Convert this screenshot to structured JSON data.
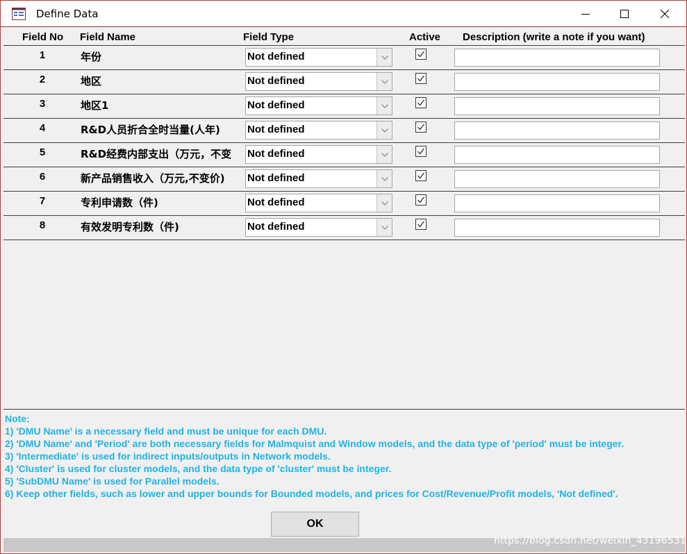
{
  "window": {
    "title": "Define Data",
    "icon": "form-icon"
  },
  "columns": {
    "field_no": "Field No",
    "field_name": "Field Name",
    "field_type": "Field Type",
    "active": "Active",
    "description": "Description (write a note if you want)"
  },
  "rows": [
    {
      "no": "1",
      "name": "年份",
      "type": "Not defined",
      "active": true,
      "description": ""
    },
    {
      "no": "2",
      "name": "地区",
      "type": "Not defined",
      "active": true,
      "description": ""
    },
    {
      "no": "3",
      "name": "地区1",
      "type": "Not defined",
      "active": true,
      "description": ""
    },
    {
      "no": "4",
      "name": "R&D人员折合全时当量(人年)",
      "type": "Not defined",
      "active": true,
      "description": ""
    },
    {
      "no": "5",
      "name": "R&D经费内部支出（万元，不变",
      "type": "Not defined",
      "active": true,
      "description": ""
    },
    {
      "no": "6",
      "name": "新产品销售收入（万元,不变价)",
      "type": "Not defined",
      "active": true,
      "description": ""
    },
    {
      "no": "7",
      "name": "专利申请数（件)",
      "type": "Not defined",
      "active": true,
      "description": ""
    },
    {
      "no": "8",
      "name": "有效发明专利数（件)",
      "type": "Not defined",
      "active": true,
      "description": ""
    }
  ],
  "notes": [
    "Note:",
    "1) 'DMU Name' is a necessary field and must be unique for each DMU.",
    "2) 'DMU Name' and 'Period' are both necessary fields for Malmquist and Window models,  and the data type of 'period' must be integer.",
    "3) 'Intermediate' is used for indirect inputs/outputs  in Network models.",
    "4) 'Cluster' is used for cluster models,  and the data type of  'cluster' must be integer.",
    "5) 'SubDMU Name' is used for Parallel models.",
    "6)  Keep other fields, such as lower and upper bounds for Bounded models, and prices for Cost/Revenue/Profit models, 'Not defined'."
  ],
  "ok_label": "OK",
  "watermark": "https://blog.csdn.net/weixin_43196531",
  "colors": {
    "note_text": "#1fb3e6",
    "title_border": "#b23a3a"
  }
}
